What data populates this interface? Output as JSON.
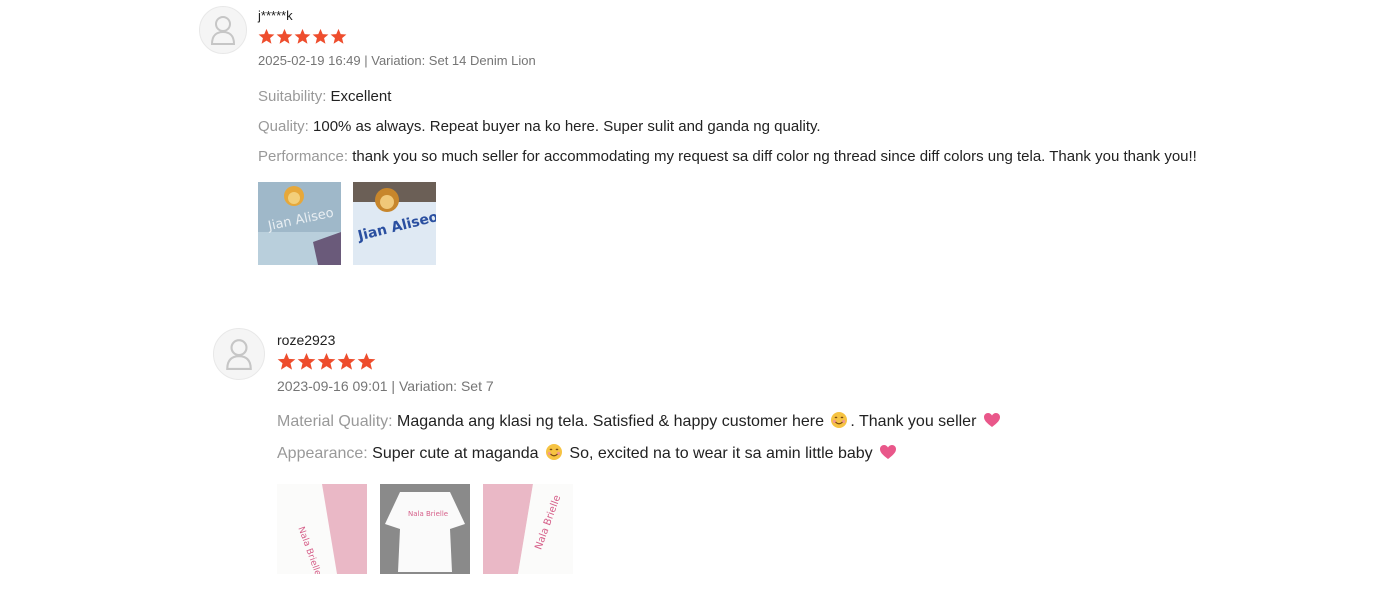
{
  "colors": {
    "star": "#ee4d2d",
    "label": "#999999",
    "meta": "#757575",
    "text": "#222222"
  },
  "reviews": [
    {
      "username": "j*****k",
      "rating": 5,
      "meta": "2025-02-19 16:49 | Variation: Set 14 Denim Lion",
      "lines": [
        {
          "label": "Suitability:",
          "text": " Excellent"
        },
        {
          "label": "Quality:",
          "text": " 100% as always. Repeat buyer na ko here. Super sulit and ganda ng quality."
        },
        {
          "label": "Performance:",
          "text": " thank you so much seller for accommodating my request sa diff color ng thread since diff colors ung tela. Thank you thank you!!"
        }
      ],
      "photos": [
        {
          "embroidery": "Jian Aliseo"
        },
        {
          "embroidery": "Jian Aliseo"
        }
      ]
    },
    {
      "username": "roze2923",
      "rating": 5,
      "meta": "2023-09-16 09:01 | Variation: Set 7",
      "lines": [
        {
          "label": "Material Quality:",
          "text_a": " Maganda ang klasi ng tela. Satisfied & happy customer here ",
          "emoji_a": "smiling-face-icon",
          "text_b": ". Thank you seller ",
          "emoji_b": "pink-heart-icon"
        },
        {
          "label": "Appearance:",
          "text_a": " Super cute at maganda ",
          "emoji_a": "smiling-face-icon",
          "text_b": "  So, excited na to wear it sa amin little baby ",
          "emoji_b": "pink-heart-icon"
        }
      ],
      "photos": [
        {
          "embroidery": "Nala Brielle"
        },
        {
          "embroidery": "Nala Brielle"
        },
        {
          "embroidery": "Nala Brielle"
        }
      ]
    }
  ]
}
